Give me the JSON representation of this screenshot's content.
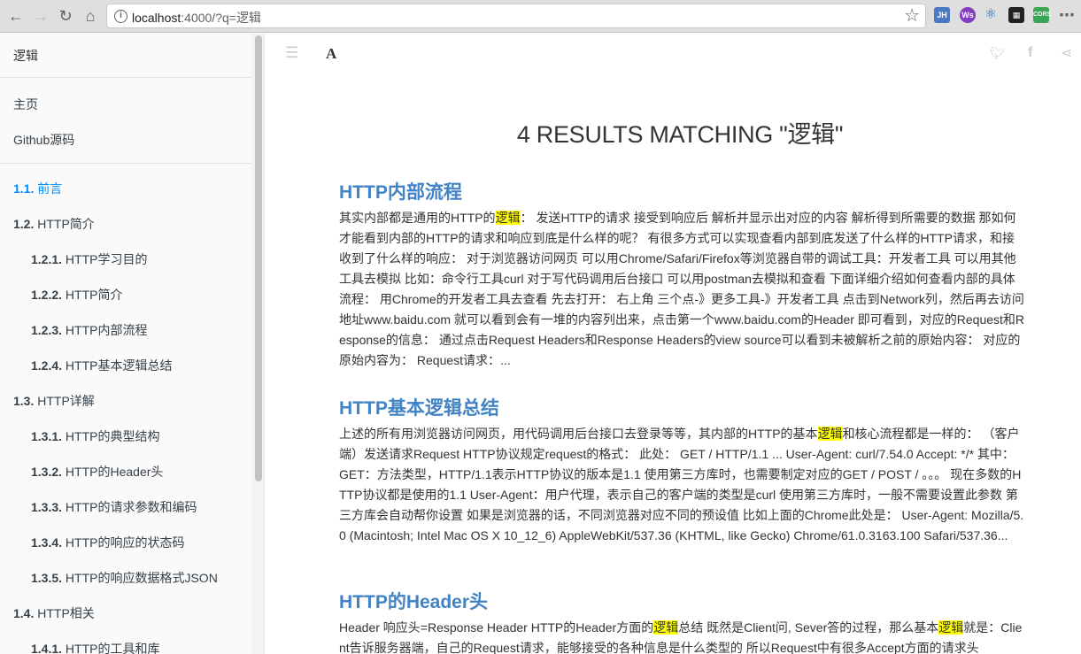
{
  "browser": {
    "url_host": "localhost",
    "url_path": ":4000/?q=逻辑",
    "extensions": [
      "JH",
      "Ws",
      "⚛",
      "▦",
      "CORS",
      "⋯"
    ]
  },
  "sidebar": {
    "search_value": "逻辑",
    "links": [
      "主页",
      "Github源码"
    ],
    "toc": [
      {
        "num": "1.1.",
        "label": "前言",
        "level": 1,
        "active": true
      },
      {
        "num": "1.2.",
        "label": "HTTP简介",
        "level": 1
      },
      {
        "num": "1.2.1.",
        "label": "HTTP学习目的",
        "level": 2
      },
      {
        "num": "1.2.2.",
        "label": "HTTP简介",
        "level": 2
      },
      {
        "num": "1.2.3.",
        "label": "HTTP内部流程",
        "level": 2
      },
      {
        "num": "1.2.4.",
        "label": "HTTP基本逻辑总结",
        "level": 2
      },
      {
        "num": "1.3.",
        "label": "HTTP详解",
        "level": 1
      },
      {
        "num": "1.3.1.",
        "label": "HTTP的典型结构",
        "level": 2
      },
      {
        "num": "1.3.2.",
        "label": "HTTP的Header头",
        "level": 2
      },
      {
        "num": "1.3.3.",
        "label": "HTTP的请求参数和编码",
        "level": 2
      },
      {
        "num": "1.3.4.",
        "label": "HTTP的响应的状态码",
        "level": 2
      },
      {
        "num": "1.3.5.",
        "label": "HTTP的响应数据格式JSON",
        "level": 2
      },
      {
        "num": "1.4.",
        "label": "HTTP相关",
        "level": 1
      },
      {
        "num": "1.4.1.",
        "label": "HTTP的工具和库",
        "level": 2
      }
    ]
  },
  "toolbar": {
    "font_label": "A"
  },
  "main": {
    "results_title": "4 RESULTS MATCHING \"逻辑\"",
    "results": [
      {
        "title": "HTTP内部流程",
        "segments": [
          {
            "t": "其实内部都是通用的HTTP的"
          },
          {
            "t": "逻辑",
            "hl": true
          },
          {
            "t": "： 发送HTTP的请求 接受到响应后 解析并显示出对应的内容 解析得到所需要的数据 那如何才能看到内部的HTTP的请求和响应到底是什么样的呢？ 有很多方式可以实现查看内部到底发送了什么样的HTTP请求，和接收到了什么样的响应： 对于浏览器访问网页 可以用Chrome/Safari/Firefox等浏览器自带的调试工具：开发者工具 可以用其他工具去模拟 比如：命令行工具curl 对于写代码调用后台接口 可以用postman去模拟和查看 下面详细介绍如何查看内部的具体流程： 用Chrome的开发者工具去查看 先去打开： 右上角 三个点-》更多工具-》开发者工具 点击到Network列，然后再去访问地址www.baidu.com 就可以看到会有一堆的内容列出来，点击第一个www.baidu.com的Header 即可看到，对应的Request和Response的信息： 通过点击Request Headers和Response Headers的view source可以看到未被解析之前的原始内容： 对应的原始内容为： Request请求：..."
          }
        ]
      },
      {
        "title": "HTTP基本逻辑总结",
        "segments": [
          {
            "t": "上述的所有用浏览器访问网页，用代码调用后台接口去登录等等，其内部的HTTP的基本"
          },
          {
            "t": "逻辑",
            "hl": true
          },
          {
            "t": "和核心流程都是一样的： （客户端）发送请求Request HTTP协议规定request的格式： 此处： GET / HTTP/1.1 ... User-Agent: curl/7.54.0 Accept: */* 其中： GET：方法类型，HTTP/1.1表示HTTP协议的版本是1.1 使用第三方库时，也需要制定对应的GET / POST / 。。。 现在多数的HTTP协议都是使用的1.1 User-Agent：用户代理，表示自己的客户端的类型是curl 使用第三方库时，一般不需要设置此参数 第三方库会自动帮你设置 如果是浏览器的话，不同浏览器对应不同的预设值 比如上面的Chrome此处是： User-Agent: Mozilla/5.0 (Macintosh; Intel Mac OS X 10_12_6) AppleWebKit/537.36 (KHTML, like Gecko) Chrome/61.0.3163.100 Safari/537.36..."
          }
        ]
      },
      {
        "title": "HTTP的Header头",
        "segments": [
          {
            "t": "Header 响应头=Response Header HTTP的Header方面的"
          },
          {
            "t": "逻辑",
            "hl": true
          },
          {
            "t": "总结 既然是Client问, Sever答的过程，那么基本"
          },
          {
            "t": "逻辑",
            "hl": true
          },
          {
            "t": "就是：Client告诉服务器端，自己的Request请求，能够接受的各种信息是什么类型的 所以Request中有很多Accept方面的请求头"
          }
        ]
      }
    ]
  }
}
